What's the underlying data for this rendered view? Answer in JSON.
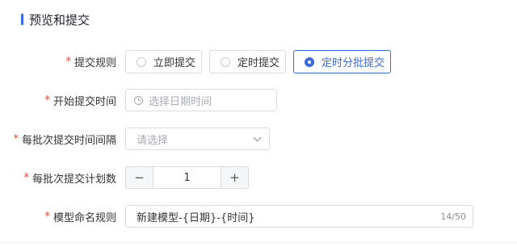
{
  "section": {
    "title": "预览和提交"
  },
  "form": {
    "required_mark": "*",
    "submit_rule": {
      "label": "提交规则",
      "options": [
        "立即提交",
        "定时提交",
        "定时分批提交"
      ],
      "selected": "定时分批提交"
    },
    "start_time": {
      "label": "开始提交时间",
      "placeholder": "选择日期时间"
    },
    "batch_interval": {
      "label": "每批次提交时间间隔",
      "placeholder": "请选择"
    },
    "batch_count": {
      "label": "每批次提交计划数",
      "value": "1",
      "minus": "−",
      "plus": "+"
    },
    "naming_rule": {
      "label": "模型命名规则",
      "value": "新建模型-{日期}-{时间}",
      "counter": "14/50"
    }
  },
  "colors": {
    "accent": "#3b68e6",
    "required": "#f03e3e",
    "border": "#d8dbe0"
  },
  "icons": {
    "start_time": "clock-icon",
    "batch_interval": "chevron-down-icon"
  }
}
